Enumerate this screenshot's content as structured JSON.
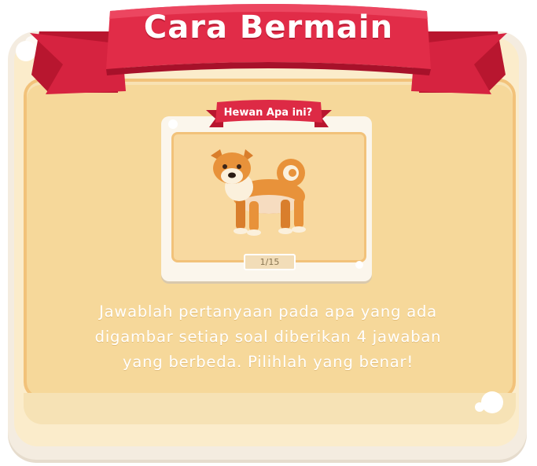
{
  "title": "Cara Bermain",
  "card": {
    "label": "Hewan Apa ini?",
    "image_icon": "shiba-dog-illustration",
    "counter": "1/15"
  },
  "instructions": [
    "Jawablah pertanyaan pada apa yang ada",
    "digambar setiap soal diberikan 4 jawaban",
    "yang berbeda. Pilihlah yang benar!"
  ],
  "colors": {
    "ribbon": "#d9213f",
    "panel": "#f6d89a",
    "text": "#ffffff"
  }
}
